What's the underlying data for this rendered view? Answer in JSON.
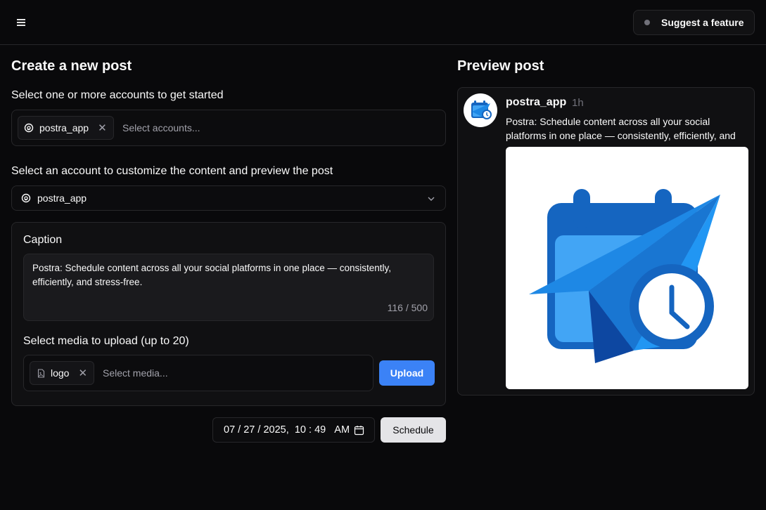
{
  "header": {
    "menu_icon": "hamburger-menu-icon",
    "suggest_label": "Suggest a feature",
    "status_dot_color": "#71717a"
  },
  "create": {
    "title": "Create a new post",
    "accounts_label": "Select one or more accounts to get started",
    "selected_accounts": [
      {
        "name": "postra_app",
        "icon": "threads-icon"
      }
    ],
    "accounts_placeholder": "Select accounts...",
    "customize_label": "Select an account to customize the content and preview the post",
    "customize_selected": "postra_app",
    "caption_label": "Caption",
    "caption_text": "Postra: Schedule content across all your social platforms in one place — consistently, efficiently, and stress-free.",
    "caption_counter": "116 / 500",
    "media_label": "Select media to upload (up to 20)",
    "media_items": [
      {
        "name": "logo",
        "icon": "file-icon"
      }
    ],
    "media_placeholder": "Select media...",
    "upload_label": "Upload",
    "upload_color": "#3b82f6"
  },
  "schedule": {
    "month": "07",
    "day": "27",
    "year": "2025",
    "hour": "10",
    "minute": "49",
    "ampm": "AM",
    "calendar_icon": "calendar-icon",
    "button_label": "Schedule"
  },
  "preview": {
    "title": "Preview post",
    "username": "postra_app",
    "time": "1h",
    "text": "Postra: Schedule content across all your social platforms in one place — consistently, efficiently, and stress-free.",
    "image_icon": "postra-logo-icon"
  }
}
